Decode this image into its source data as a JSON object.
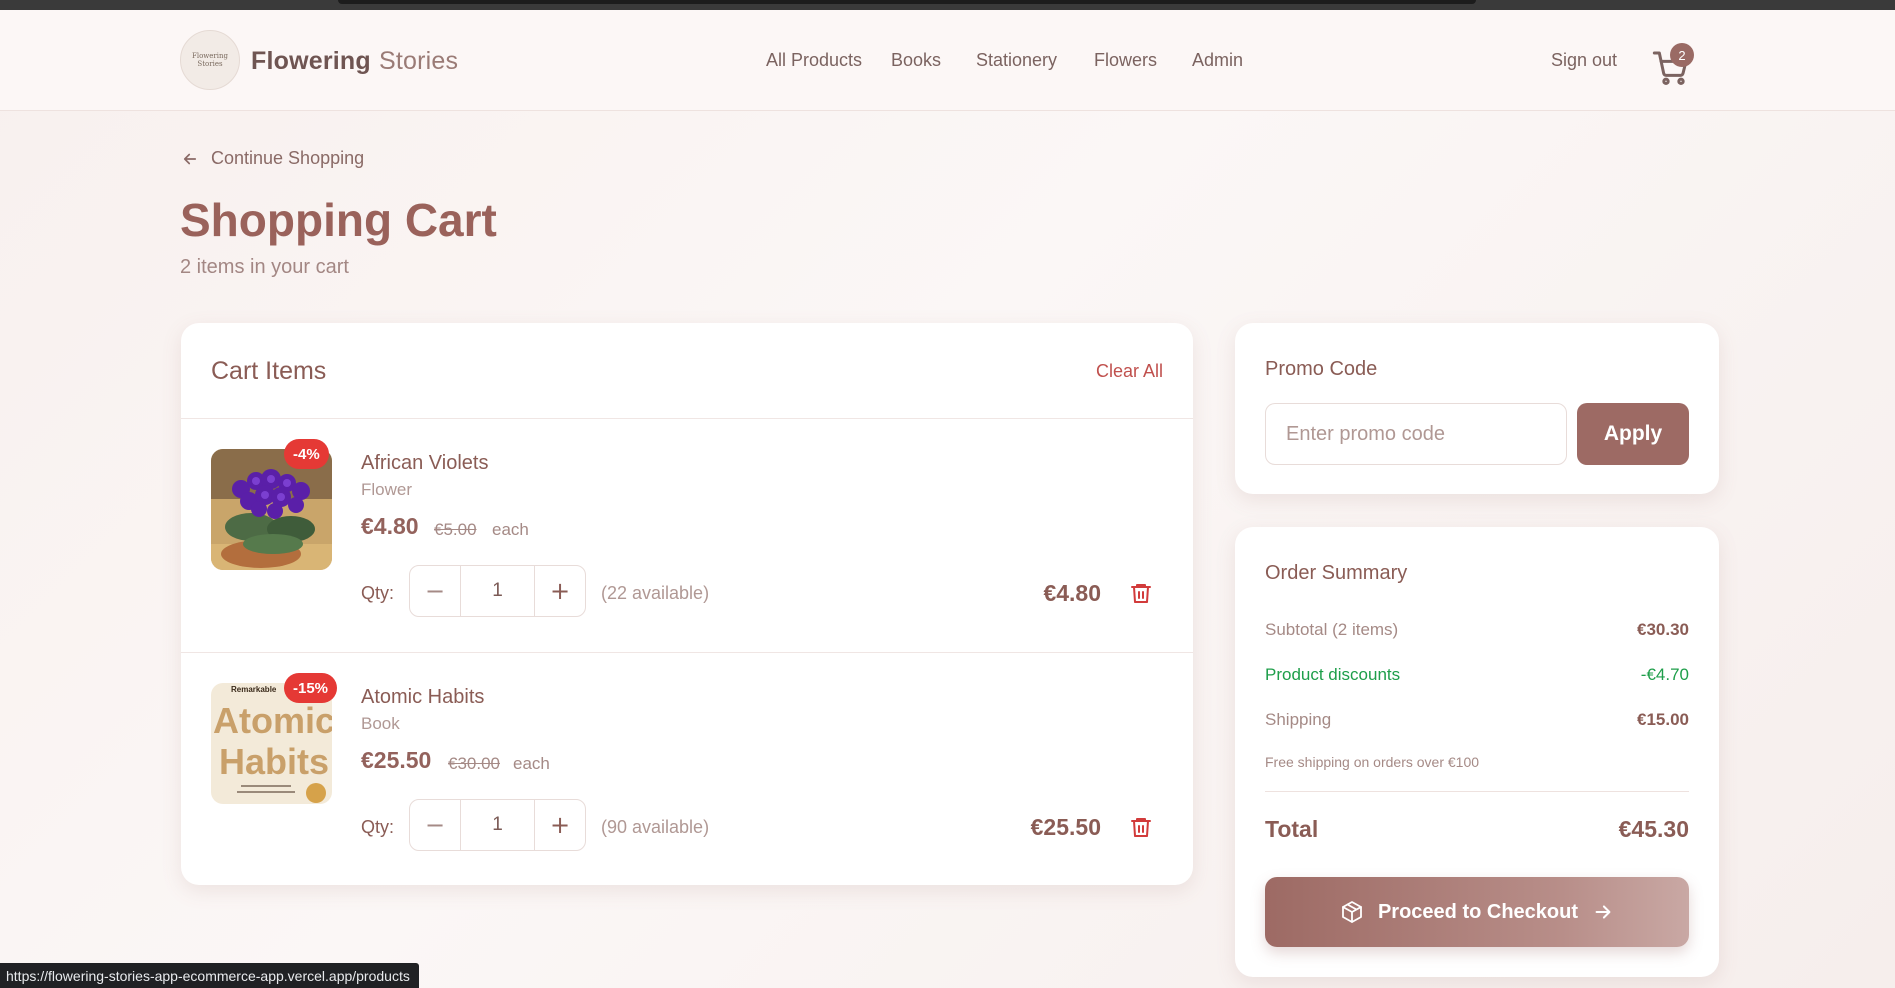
{
  "header": {
    "brand_bold": "Flowering",
    "brand_light": "Stories",
    "logo_text": "Flowering Stories",
    "nav": [
      "All Products",
      "Books",
      "Stationery",
      "Flowers",
      "Admin"
    ],
    "signout_label": "Sign out",
    "cart_count": "2"
  },
  "page": {
    "back_label": "Continue Shopping",
    "title": "Shopping Cart",
    "subtitle": "2 items in your cart"
  },
  "cart": {
    "title": "Cart Items",
    "clear_label": "Clear All",
    "qty_label": "Qty:",
    "each_label": "each",
    "items": [
      {
        "name": "African Violets",
        "category": "Flower",
        "price": "€4.80",
        "old_price": "€5.00",
        "discount": "-4%",
        "quantity": "1",
        "available": "(22 available)",
        "line_total": "€4.80"
      },
      {
        "name": "Atomic Habits",
        "category": "Book",
        "price": "€25.50",
        "old_price": "€30.00",
        "discount": "-15%",
        "quantity": "1",
        "available": "(90 available)",
        "line_total": "€25.50",
        "cover_top": "Remarkable",
        "cover_title_1": "Atomic",
        "cover_title_2": "Habits"
      }
    ]
  },
  "promo": {
    "title": "Promo Code",
    "placeholder": "Enter promo code",
    "apply_label": "Apply"
  },
  "summary": {
    "title": "Order Summary",
    "subtotal_label": "Subtotal (2 items)",
    "subtotal_value": "€30.30",
    "discount_label": "Product discounts",
    "discount_value": "-€4.70",
    "shipping_label": "Shipping",
    "shipping_value": "€15.00",
    "free_note": "Free shipping on orders over €100",
    "total_label": "Total",
    "total_value": "€45.30",
    "checkout_label": "Proceed to Checkout"
  },
  "status_url": "https://flowering-stories-app-ecommerce-app.vercel.app/products",
  "colors": {
    "accent": "#9d6a64",
    "discount_badge": "#e53935",
    "green": "#1e9e4a",
    "danger": "#c0504d"
  }
}
